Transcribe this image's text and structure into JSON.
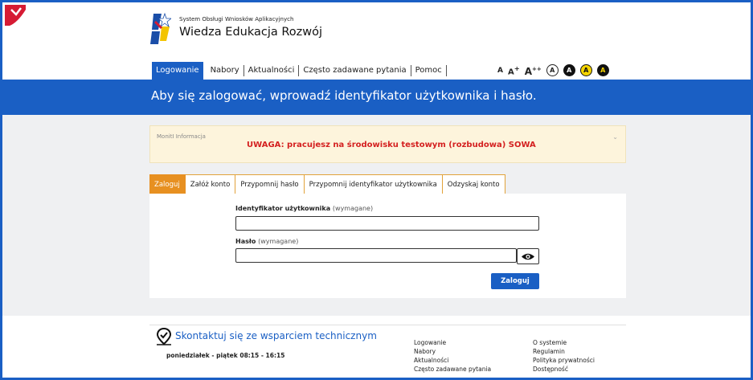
{
  "header": {
    "subtitle": "System Obsługi Wniosków Aplikacyjnych",
    "title": "Wiedza Edukacja Rozwój"
  },
  "nav": {
    "items": [
      {
        "label": "Logowanie",
        "active": true
      },
      {
        "label": "Nabory",
        "active": false
      },
      {
        "label": "Aktualności",
        "active": false
      },
      {
        "label": "Często zadawane pytania",
        "active": false
      },
      {
        "label": "Pomoc",
        "active": false
      }
    ]
  },
  "accessibility": {
    "font_small": "A",
    "font_medium": "A",
    "font_medium_sup": "+",
    "font_large": "A",
    "font_large_sup": "++",
    "contrast_labels": [
      "A",
      "A",
      "A",
      "A"
    ]
  },
  "banner": {
    "text": "Aby się zalogować, wprowadź identyfikator użytkownika i hasło."
  },
  "notice": {
    "label": "MonitI Informacja",
    "text": "UWAGA: pracujesz na środowisku testowym (rozbudowa) SOWA",
    "chevron": "⌄"
  },
  "tabs": [
    {
      "label": "Zaloguj",
      "active": true
    },
    {
      "label": "Załóż konto",
      "active": false
    },
    {
      "label": "Przypomnij hasło",
      "active": false
    },
    {
      "label": "Przypomnij identyfikator użytkownika",
      "active": false
    },
    {
      "label": "Odzyskaj konto",
      "active": false
    }
  ],
  "form": {
    "username_label": "Identyfikator użytkownika",
    "username_required": "(wymagane)",
    "username_value": "",
    "password_label": "Hasło",
    "password_required": "(wymagane)",
    "password_value": "",
    "submit_label": "Zaloguj"
  },
  "footer": {
    "support_title": "Skontaktuj się ze wsparciem technicznym",
    "support_hours": "poniedziałek - piątek 08:15 - 16:15",
    "col1": [
      "Logowanie",
      "Nabory",
      "Aktualności",
      "Często zadawane pytania"
    ],
    "col2": [
      "O systemie",
      "Regulamin",
      "Polityka prywatności",
      "Dostępność"
    ]
  },
  "colors": {
    "primary": "#1a5fc4",
    "tab_active": "#e79021",
    "notice_bg": "#fdf4dc",
    "notice_text": "#d42020"
  }
}
